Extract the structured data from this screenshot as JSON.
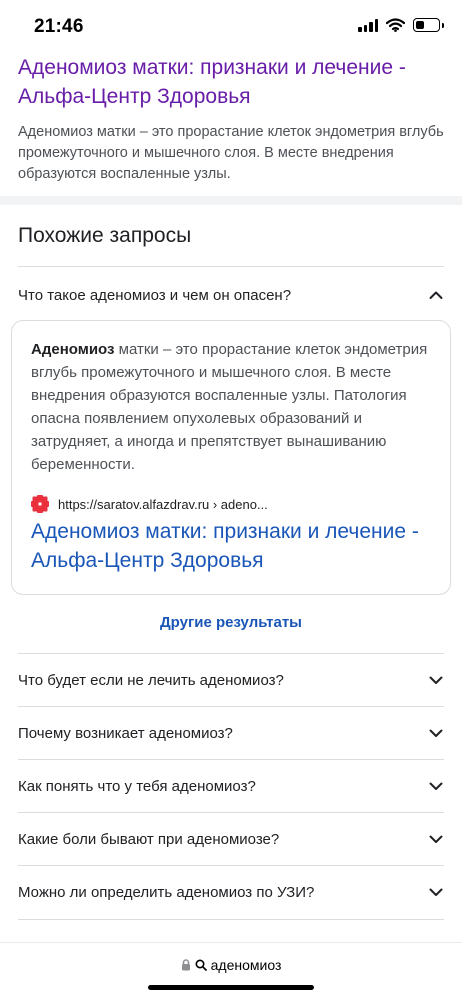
{
  "status_bar": {
    "time": "21:46"
  },
  "top_result": {
    "title": "Аденомиоз матки: признаки и лечение - Альфа-Центр Здоровья",
    "snippet": "Аденомиоз матки – это прорастание клеток эндометрия вглубь промежуточного и мышечного слоя. В месте внедрения образуются воспаленные узлы."
  },
  "related": {
    "heading": "Похожие запросы",
    "expanded_question": "Что такое аденомиоз и чем он опасен?",
    "answer": {
      "bold_term": "Аденомиоз",
      "text": " матки – это прорастание клеток эндометрия вглубь промежуточного и мышечного слоя. В месте внедрения образуются воспаленные узлы. Патология опасна появлением опухолевых образований и затрудняет, а иногда и препятствует вынашиванию беременности.",
      "source_url": "https://saratov.alfazdrav.ru › adeno...",
      "source_title": "Аденомиоз матки: признаки и лечение - Альфа-Центр Здоровья"
    },
    "more_results_label": "Другие результаты",
    "questions": [
      "Что будет если не лечить аденомиоз?",
      "Почему возникает аденомиоз?",
      "Как понять что у тебя аденомиоз?",
      "Какие боли бывают при аденомиозе?",
      "Можно ли определить аденомиоз по УЗИ?"
    ]
  },
  "browser": {
    "query": "аденомиоз"
  },
  "colors": {
    "visited_link": "#681da8",
    "link": "#1a56b8",
    "favicon": "#e8313d"
  }
}
